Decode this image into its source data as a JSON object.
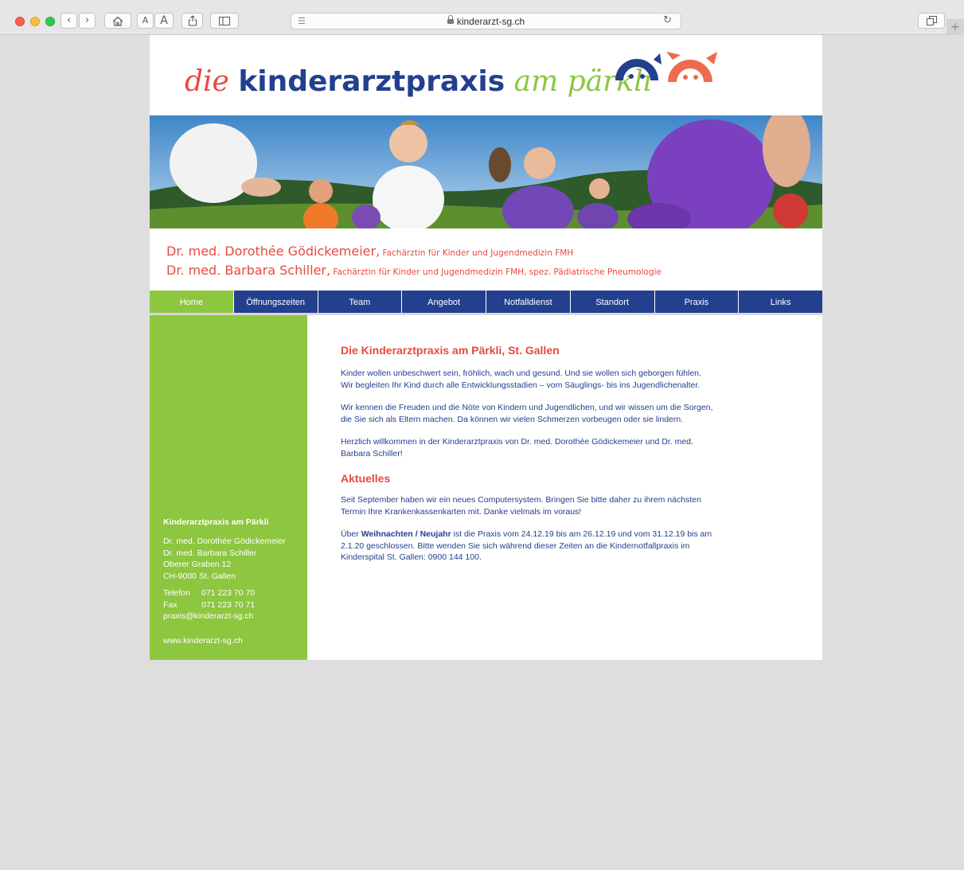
{
  "browser": {
    "url": "kinderarzt-sg.ch",
    "text_size_small": "A",
    "text_size_large": "A"
  },
  "site": {
    "logo": {
      "part1": "die ",
      "part2": "kinderarztpraxis",
      "part3": " am pärkli"
    },
    "colors": {
      "navy": "#23408f",
      "green": "#8dc63f",
      "coral": "#e8493f"
    },
    "doctors": [
      {
        "name": "Dr. med. Dorothée Gödickemeier,",
        "title": " Fachärztin für Kinder und Jugendmedizin FMH"
      },
      {
        "name": "Dr. med. Barbara Schiller,",
        "title": " Fachärztin für Kinder und Jugendmedizin FMH, spez. Pädiatrische Pneumologie"
      }
    ],
    "nav": [
      {
        "label": "Home",
        "active": true
      },
      {
        "label": "Öffnungszeiten"
      },
      {
        "label": "Team"
      },
      {
        "label": "Angebot"
      },
      {
        "label": "Notfalldienst"
      },
      {
        "label": "Standort"
      },
      {
        "label": "Praxis"
      },
      {
        "label": "Links"
      }
    ],
    "sidebar": {
      "title": "Kinderarztpraxis am Pärkli",
      "address": [
        "Dr. med. Dorothée Gödickemeier",
        "Dr. med. Barbara Schiller",
        "Oberer Graben 12",
        "CH-9000 St. Gallen"
      ],
      "phone_label": "Telefon",
      "phone": "071 223 70 70",
      "fax_label": "Fax",
      "fax": "071 223 70 71",
      "email": "praxis@kinderarzt-sg.ch",
      "web": "www.kinderarzt-sg.ch"
    },
    "content": {
      "heading": "Die Kinderarztpraxis am Pärkli, St. Gallen",
      "intro": [
        "Kinder wollen unbeschwert sein, fröhlich, wach und gesund. Und sie wollen sich geborgen fühlen. Wir begleiten Ihr Kind durch alle Entwicklungsstadien – vom Säuglings- bis ins Jugendlichenalter.",
        "Wir kennen die Freuden und die Nöte von Kindern und Jugendlichen, und wir wissen um die Sorgen, die Sie sich als Eltern machen. Da können wir vielen Schmerzen vorbeugen oder sie lindern.",
        "Herzlich willkommen in der Kinderarztpraxis von Dr. med. Dorothée Gödickemeier und Dr. med. Barbara Schiller!"
      ],
      "news_heading": "Aktuelles",
      "news1": "Seit September haben wir ein neues Computersystem. Bringen Sie bitte daher zu ihrem nächsten Termin Ihre Krankenkassenkarten mit. Danke vielmals im voraus!",
      "news2_pre": "Über ",
      "news2_bold": "Weihnachten / Neujahr",
      "news2_post": " ist die Praxis vom 24.12.19 bis am 26.12.19 und vom 31.12.19 bis am 2.1.20  geschlossen. Bitte wenden Sie sich während dieser Zeiten an die Kindernotfallpraxis im Kinderspital St. Gallen: 0900 144 100."
    }
  }
}
